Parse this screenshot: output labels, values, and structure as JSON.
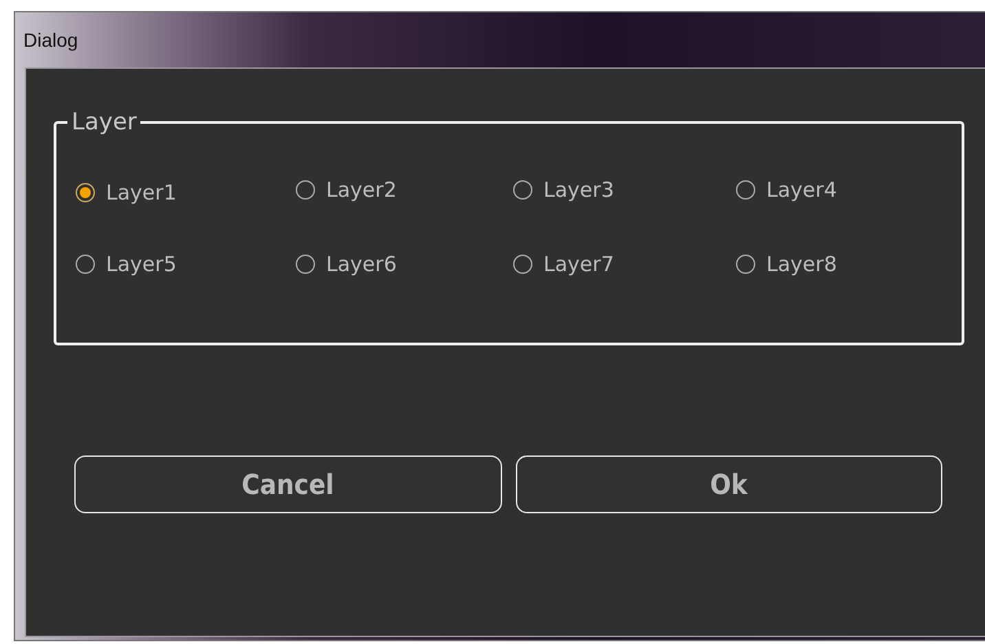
{
  "window": {
    "title": "Dialog"
  },
  "group": {
    "title": "Layer",
    "options": [
      {
        "label": "Layer1",
        "selected": true
      },
      {
        "label": "Layer2",
        "selected": false
      },
      {
        "label": "Layer3",
        "selected": false
      },
      {
        "label": "Layer4",
        "selected": false
      },
      {
        "label": "Layer5",
        "selected": false
      },
      {
        "label": "Layer6",
        "selected": false
      },
      {
        "label": "Layer7",
        "selected": false
      },
      {
        "label": "Layer8",
        "selected": false
      }
    ]
  },
  "buttons": [
    "Cancel",
    "Ok"
  ]
}
